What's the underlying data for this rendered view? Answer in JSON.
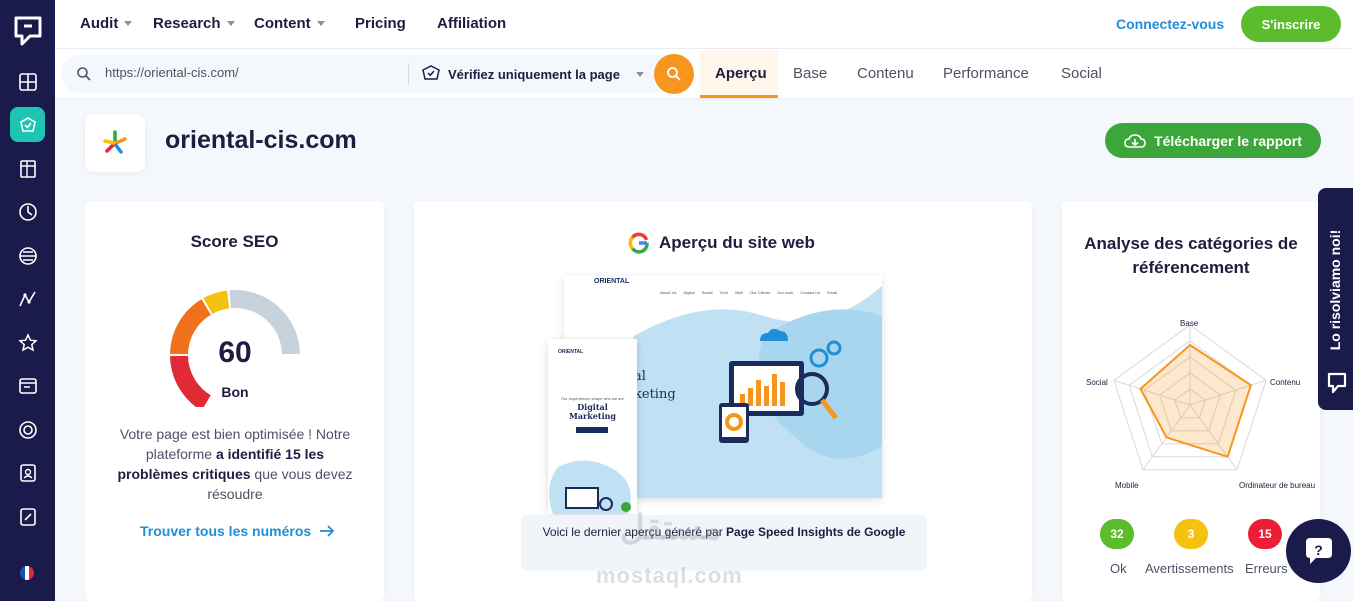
{
  "nav": {
    "items": [
      {
        "label": "Audit",
        "dropdown": true
      },
      {
        "label": "Research",
        "dropdown": true
      },
      {
        "label": "Content",
        "dropdown": true
      },
      {
        "label": "Pricing",
        "dropdown": false
      },
      {
        "label": "Affiliation",
        "dropdown": false
      }
    ],
    "connect_label": "Connectez-vous",
    "signup_label": "S'inscrire"
  },
  "search": {
    "url_value": "https://oriental-cis.com/",
    "mode_label": "Vérifiez uniquement la page"
  },
  "tabs": [
    "Aperçu",
    "Base",
    "Contenu",
    "Performance",
    "Social"
  ],
  "active_tab": "Aperçu",
  "site": {
    "domain": "oriental-cis.com",
    "download_label": "Télécharger le rapport"
  },
  "seo_card": {
    "title": "Score SEO",
    "score": "60",
    "score_fraction": 0.6,
    "rating": "Bon",
    "desc_pre": "Votre page est bien optimisée ! Notre plateforme ",
    "desc_bold": "a identifié 15 les problèmes critiques",
    "desc_post": " que vous devez résoudre",
    "link_label": "Trouver tous les numéros"
  },
  "preview_card": {
    "title": "Aperçu du site web",
    "caption_pre": "Voici le dernier aperçu généré par ",
    "caption_bold": "Page Speed Insights de Google",
    "mock_brand": "ORIENTAL",
    "mock_nav": [
      "About Us",
      "Digital",
      "Social",
      "Tech",
      "Web",
      "Our Clients",
      "Our work",
      "Contact Us",
      "Email"
    ],
    "mock_mobile_tagline": "Our experiences shape who we are",
    "mock_mobile_heading": "Digital Marketing",
    "mock_hero_partial": "al keting"
  },
  "category_card": {
    "title": "Analyse des catégories de référencement",
    "radar_axes": [
      "Base",
      "Contenu",
      "Ordinateur de bureau",
      "Mobile",
      "Social"
    ],
    "radar_values": [
      0.75,
      0.8,
      0.8,
      0.5,
      0.65
    ],
    "badges": [
      {
        "count": "32",
        "label": "Ok",
        "color": "#5bbd2b"
      },
      {
        "count": "3",
        "label": "Avertissements",
        "color": "#f5c20f"
      },
      {
        "count": "15",
        "label": "Erreurs",
        "color": "#ee1d36"
      }
    ]
  },
  "feedback_label": "Lo risolviamo noi!",
  "chat_label": "?",
  "watermark": {
    "arabic": "مستقل",
    "latin": "mostaql.com"
  },
  "colors": {
    "sidebar": "#1a1a4b",
    "accent": "#f7961e",
    "green": "#3ca63a",
    "teal": "#1fc5b3",
    "link": "#1e8fd8"
  },
  "sidebar_icons": [
    "dashboard-icon",
    "seo-checker-icon",
    "pages-icon",
    "keyword-icon",
    "rank-icon",
    "analytics-icon",
    "backlinks-icon",
    "report-icon",
    "competitor-icon",
    "audience-icon",
    "content-icon"
  ]
}
